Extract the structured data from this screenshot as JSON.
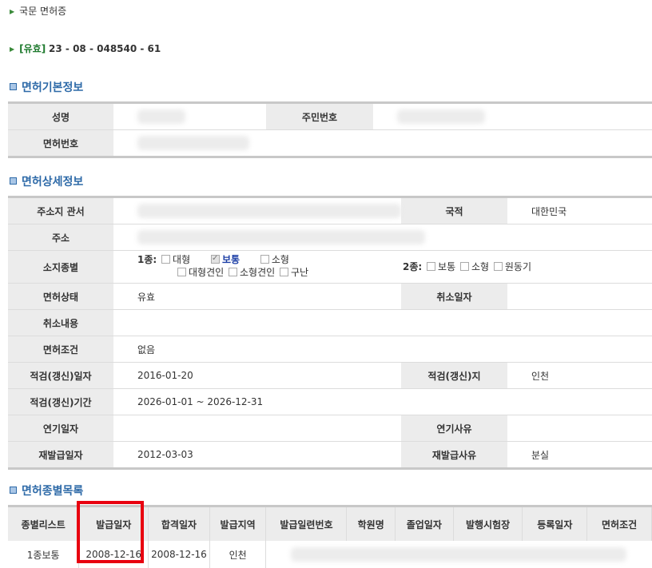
{
  "header": {
    "license_title": "국문 면허증",
    "status": "[유효]",
    "license_number": "23 - 08 - 048540 - 61"
  },
  "basic": {
    "title": "면허기본정보",
    "name_label": "성명",
    "rrn_label": "주민번호",
    "license_no_label": "면허번호"
  },
  "detail": {
    "title": "면허상세정보",
    "rows": {
      "address_office_label": "주소지 관서",
      "nationality_label": "국적",
      "nationality_value": "대한민국",
      "address_label": "주소",
      "license_types_label": "소지종별",
      "class1_label": "1종:",
      "class1_options": [
        "대형",
        "보통",
        "소형",
        "대형견인",
        "소형견인",
        "구난"
      ],
      "class1_checked": "보통",
      "class2_label": "2종:",
      "class2_options": [
        "보통",
        "소형",
        "원동기"
      ],
      "status_label": "면허상태",
      "status_value": "유효",
      "cancel_date_label": "취소일자",
      "cancel_content_label": "취소내용",
      "conditions_label": "면허조건",
      "conditions_value": "없음",
      "renewal_date_label": "적검(갱신)일자",
      "renewal_date_value": "2016-01-20",
      "renewal_place_label": "적검(갱신)지",
      "renewal_place_value": "인천",
      "renewal_period_label": "적검(갱신)기간",
      "renewal_period_value": "2026-01-01 ~ 2026-12-31",
      "postpone_date_label": "연기일자",
      "postpone_reason_label": "연기사유",
      "reissue_date_label": "재발급일자",
      "reissue_date_value": "2012-03-03",
      "reissue_reason_label": "재발급사유",
      "reissue_reason_value": "분실"
    }
  },
  "list": {
    "title": "면허종별목록",
    "columns": [
      "종별리스트",
      "발급일자",
      "합격일자",
      "발급지역",
      "발급일련번호",
      "학원명",
      "졸업일자",
      "발행시험장",
      "등록일자",
      "면허조건"
    ],
    "rows": [
      {
        "type": "1종보통",
        "issue_date": "2008-12-16",
        "pass_date": "2008-12-16",
        "region": "인천"
      }
    ]
  }
}
